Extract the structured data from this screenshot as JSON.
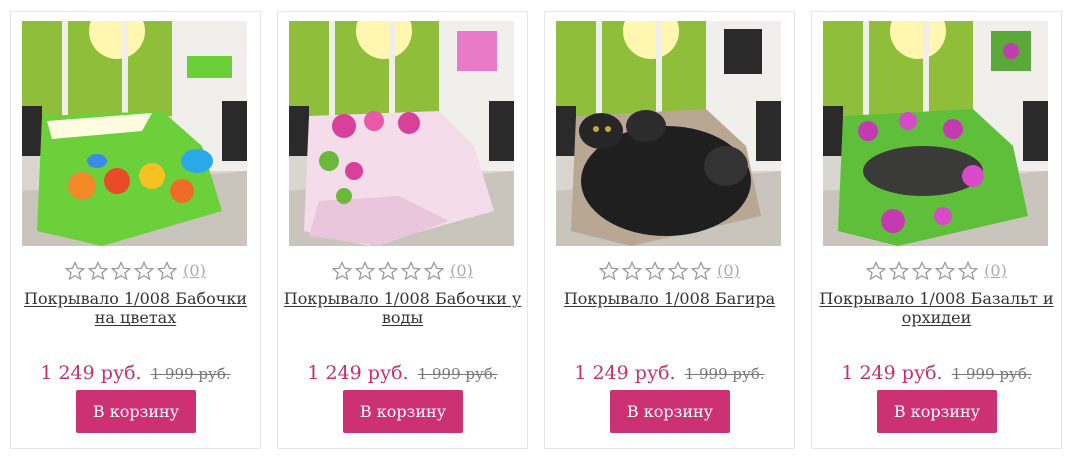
{
  "products": [
    {
      "title": "Покрывало 1/008 Бабочки на цветах",
      "rating_count": "(0)",
      "price": "1 249 руб.",
      "old_price": "1 999 руб.",
      "button": "В корзину",
      "picture": "tulips-butterflies",
      "accent": "#e84a2a"
    },
    {
      "title": "Покрывало 1/008 Бабочки у воды",
      "rating_count": "(0)",
      "price": "1 249 руб.",
      "old_price": "1 999 руб.",
      "button": "В корзину",
      "picture": "pink-flowers",
      "accent": "#d8409a"
    },
    {
      "title": "Покрывало 1/008 Багира",
      "rating_count": "(0)",
      "price": "1 249 руб.",
      "old_price": "1 999 руб.",
      "button": "В корзину",
      "picture": "black-panther",
      "accent": "#222222"
    },
    {
      "title": "Покрывало 1/008 Базальт и орхидеи",
      "rating_count": "(0)",
      "price": "1 249 руб.",
      "old_price": "1 999 руб.",
      "button": "В корзину",
      "picture": "basalt-orchids",
      "accent": "#c43ab0"
    }
  ]
}
